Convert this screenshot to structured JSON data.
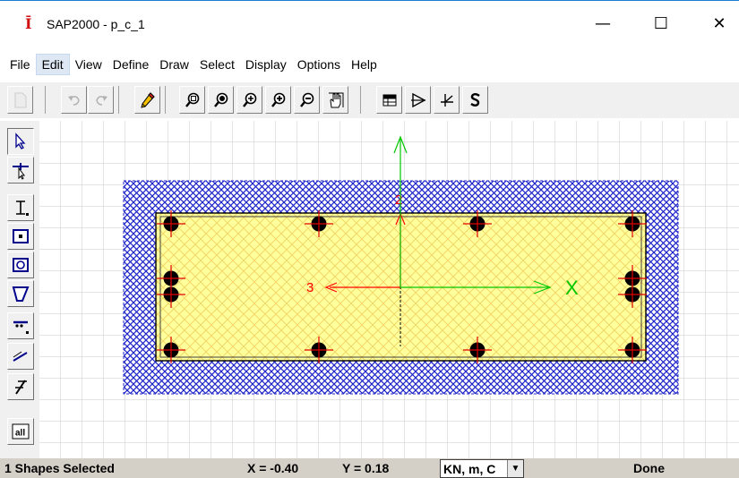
{
  "window": {
    "icon_glyph": "Ī",
    "title": "SAP2000 - p_c_1",
    "minimize_glyph": "—",
    "maximize_glyph": "☐",
    "close_glyph": "✕"
  },
  "menu": {
    "items": [
      "File",
      "Edit",
      "View",
      "Define",
      "Draw",
      "Select",
      "Display",
      "Options",
      "Help"
    ],
    "active": "Edit"
  },
  "toolbar": {
    "buttons": [
      {
        "icon": "new-icon",
        "enabled": false
      },
      {
        "icon": "undo-icon",
        "enabled": false
      },
      {
        "icon": "redo-icon",
        "enabled": false
      },
      {
        "icon": "pencil-icon",
        "enabled": true
      },
      {
        "icon": "zoom-window-icon",
        "enabled": true
      },
      {
        "icon": "zoom-restore-icon",
        "enabled": true
      },
      {
        "icon": "zoom-pan-icon",
        "enabled": true
      },
      {
        "icon": "zoom-in-icon",
        "enabled": true
      },
      {
        "icon": "zoom-out-icon",
        "enabled": true
      },
      {
        "icon": "pan-hand-icon",
        "enabled": true
      },
      {
        "icon": "table-icon",
        "enabled": true
      },
      {
        "icon": "section-properties-icon",
        "enabled": true
      },
      {
        "icon": "axes-icon",
        "enabled": true
      },
      {
        "icon": "s-icon",
        "enabled": true
      }
    ]
  },
  "side_toolbar": {
    "buttons": [
      {
        "icon": "pointer-icon",
        "pressed": true
      },
      {
        "icon": "reshape-pointer-icon",
        "pressed": false
      },
      {
        "icon": "i-section-icon",
        "pressed": false
      },
      {
        "icon": "rectangle-section-icon",
        "pressed": false
      },
      {
        "icon": "circle-section-icon",
        "pressed": false
      },
      {
        "icon": "polygon-section-icon",
        "pressed": false
      },
      {
        "icon": "rebar-line-icon",
        "pressed": false
      },
      {
        "icon": "line-draw-icon",
        "pressed": false
      },
      {
        "icon": "reference-line-icon",
        "pressed": false
      },
      {
        "icon": "select-all-icon",
        "label": "all",
        "pressed": false
      }
    ]
  },
  "canvas": {
    "axis_labels": {
      "vertical": "2",
      "horizontal": "3",
      "x_axis": "X"
    },
    "colors": {
      "cover_hatch": "#1c22c8",
      "core_fill": "#ffff9c",
      "core_hatch": "#f2d060",
      "rebar": "#000000",
      "rebar_cross": "#e00000",
      "local_axes": "#ff0000",
      "global_axes": "#00c800",
      "grid": "#c8c8c8"
    }
  },
  "status": {
    "selection": "1 Shapes Selected",
    "x_readout": "X = -0.40",
    "y_readout": "Y = 0.18",
    "units": "KN, m, C",
    "units_arrow": "▼",
    "state": "Done"
  }
}
